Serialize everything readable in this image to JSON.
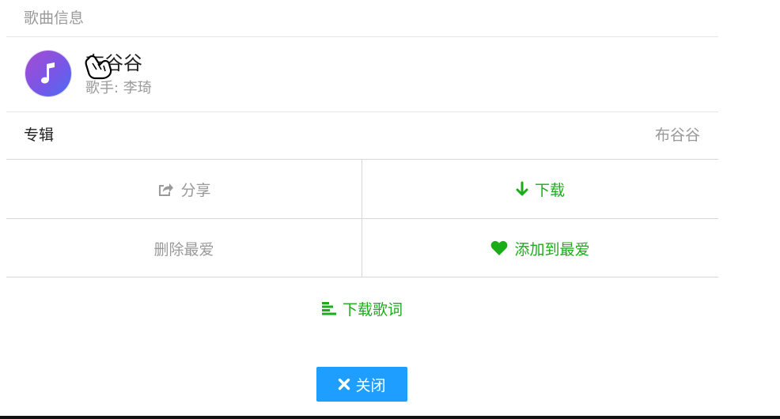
{
  "header": {
    "title": "歌曲信息"
  },
  "song": {
    "title": "布谷谷",
    "artist_label": "歌手: 李琦",
    "cover_icon": "music-note-icon"
  },
  "album": {
    "label": "专辑",
    "value": "布谷谷"
  },
  "actions": {
    "share_label": "分享",
    "download_label": "下载",
    "remove_favorite_label": "删除最爱",
    "add_favorite_label": "添加到最爱",
    "download_lyrics_label": "下载歌词",
    "close_label": "关闭"
  },
  "colors": {
    "accent_green": "#1aad19",
    "muted_gray": "#9a9a9a",
    "close_button_blue": "#1e9fff"
  }
}
